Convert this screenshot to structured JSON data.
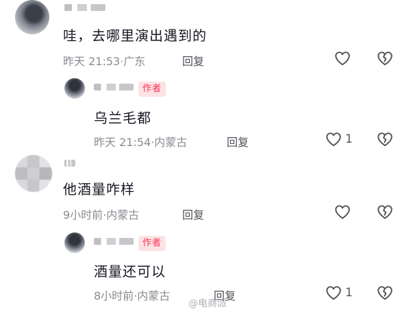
{
  "comments": [
    {
      "text": "哇，去哪里演出遇到的",
      "time": "昨天 21:53",
      "location": "广东",
      "reply_label": "回复",
      "like_count": ""
    },
    {
      "badge": "作者",
      "text": "乌兰毛都",
      "time": "昨天 21:54",
      "location": "内蒙古",
      "reply_label": "回复",
      "like_count": "1"
    },
    {
      "text": "他酒量咋样",
      "time": "9小时前",
      "location": "内蒙古",
      "reply_label": "回复",
      "like_count": ""
    },
    {
      "badge": "作者",
      "text": "酒量还可以",
      "time": "8小时前",
      "location": "内蒙古",
      "reply_label": "回复",
      "like_count": "1"
    }
  ],
  "separator": "·",
  "icons": {
    "like": "heart-outline-icon",
    "dislike": "broken-heart-icon"
  },
  "colors": {
    "author_badge_bg": "#fde2e4",
    "author_badge_text": "#fe2c55",
    "meta_text": "#8a8b91"
  },
  "watermark": "@电商派"
}
